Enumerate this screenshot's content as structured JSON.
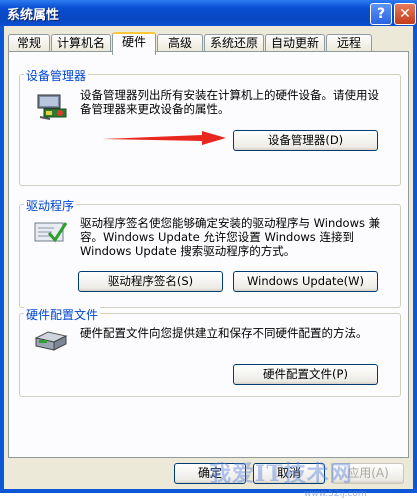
{
  "window": {
    "title": "系统属性",
    "help_glyph": "?",
    "close_glyph": "✕"
  },
  "tabs": [
    "常规",
    "计算机名",
    "硬件",
    "高级",
    "系统还原",
    "自动更新",
    "远程"
  ],
  "active_tab": "硬件",
  "device_manager": {
    "title": "设备管理器",
    "description": "设备管理器列出所有安装在计算机上的硬件设备。请使用设备管理器来更改设备的属性。",
    "button": "设备管理器(D)"
  },
  "drivers": {
    "title": "驱动程序",
    "description": "驱动程序签名使您能够确定安装的驱动程序与 Windows 兼容。Windows Update 允许您设置 Windows 连接到 Windows Update 搜索驱动程序的方式。",
    "signing_button": "驱动程序签名(S)",
    "update_button": "Windows Update(W)"
  },
  "hardware_profiles": {
    "title": "硬件配置文件",
    "description": "硬件配置文件向您提供建立和保存不同硬件配置的方法。",
    "button": "硬件配置文件(P)"
  },
  "footer": {
    "ok": "确定",
    "cancel": "取消",
    "apply": "应用(A)"
  },
  "watermark": {
    "text": "我爱IT技术网",
    "url": "www.52ij.com"
  },
  "colors": {
    "accent": "#0046d5",
    "arrow": "#e8281e"
  },
  "icons": [
    "device-manager-icon",
    "driver-signing-icon",
    "hardware-profile-icon",
    "red-arrow-icon"
  ]
}
